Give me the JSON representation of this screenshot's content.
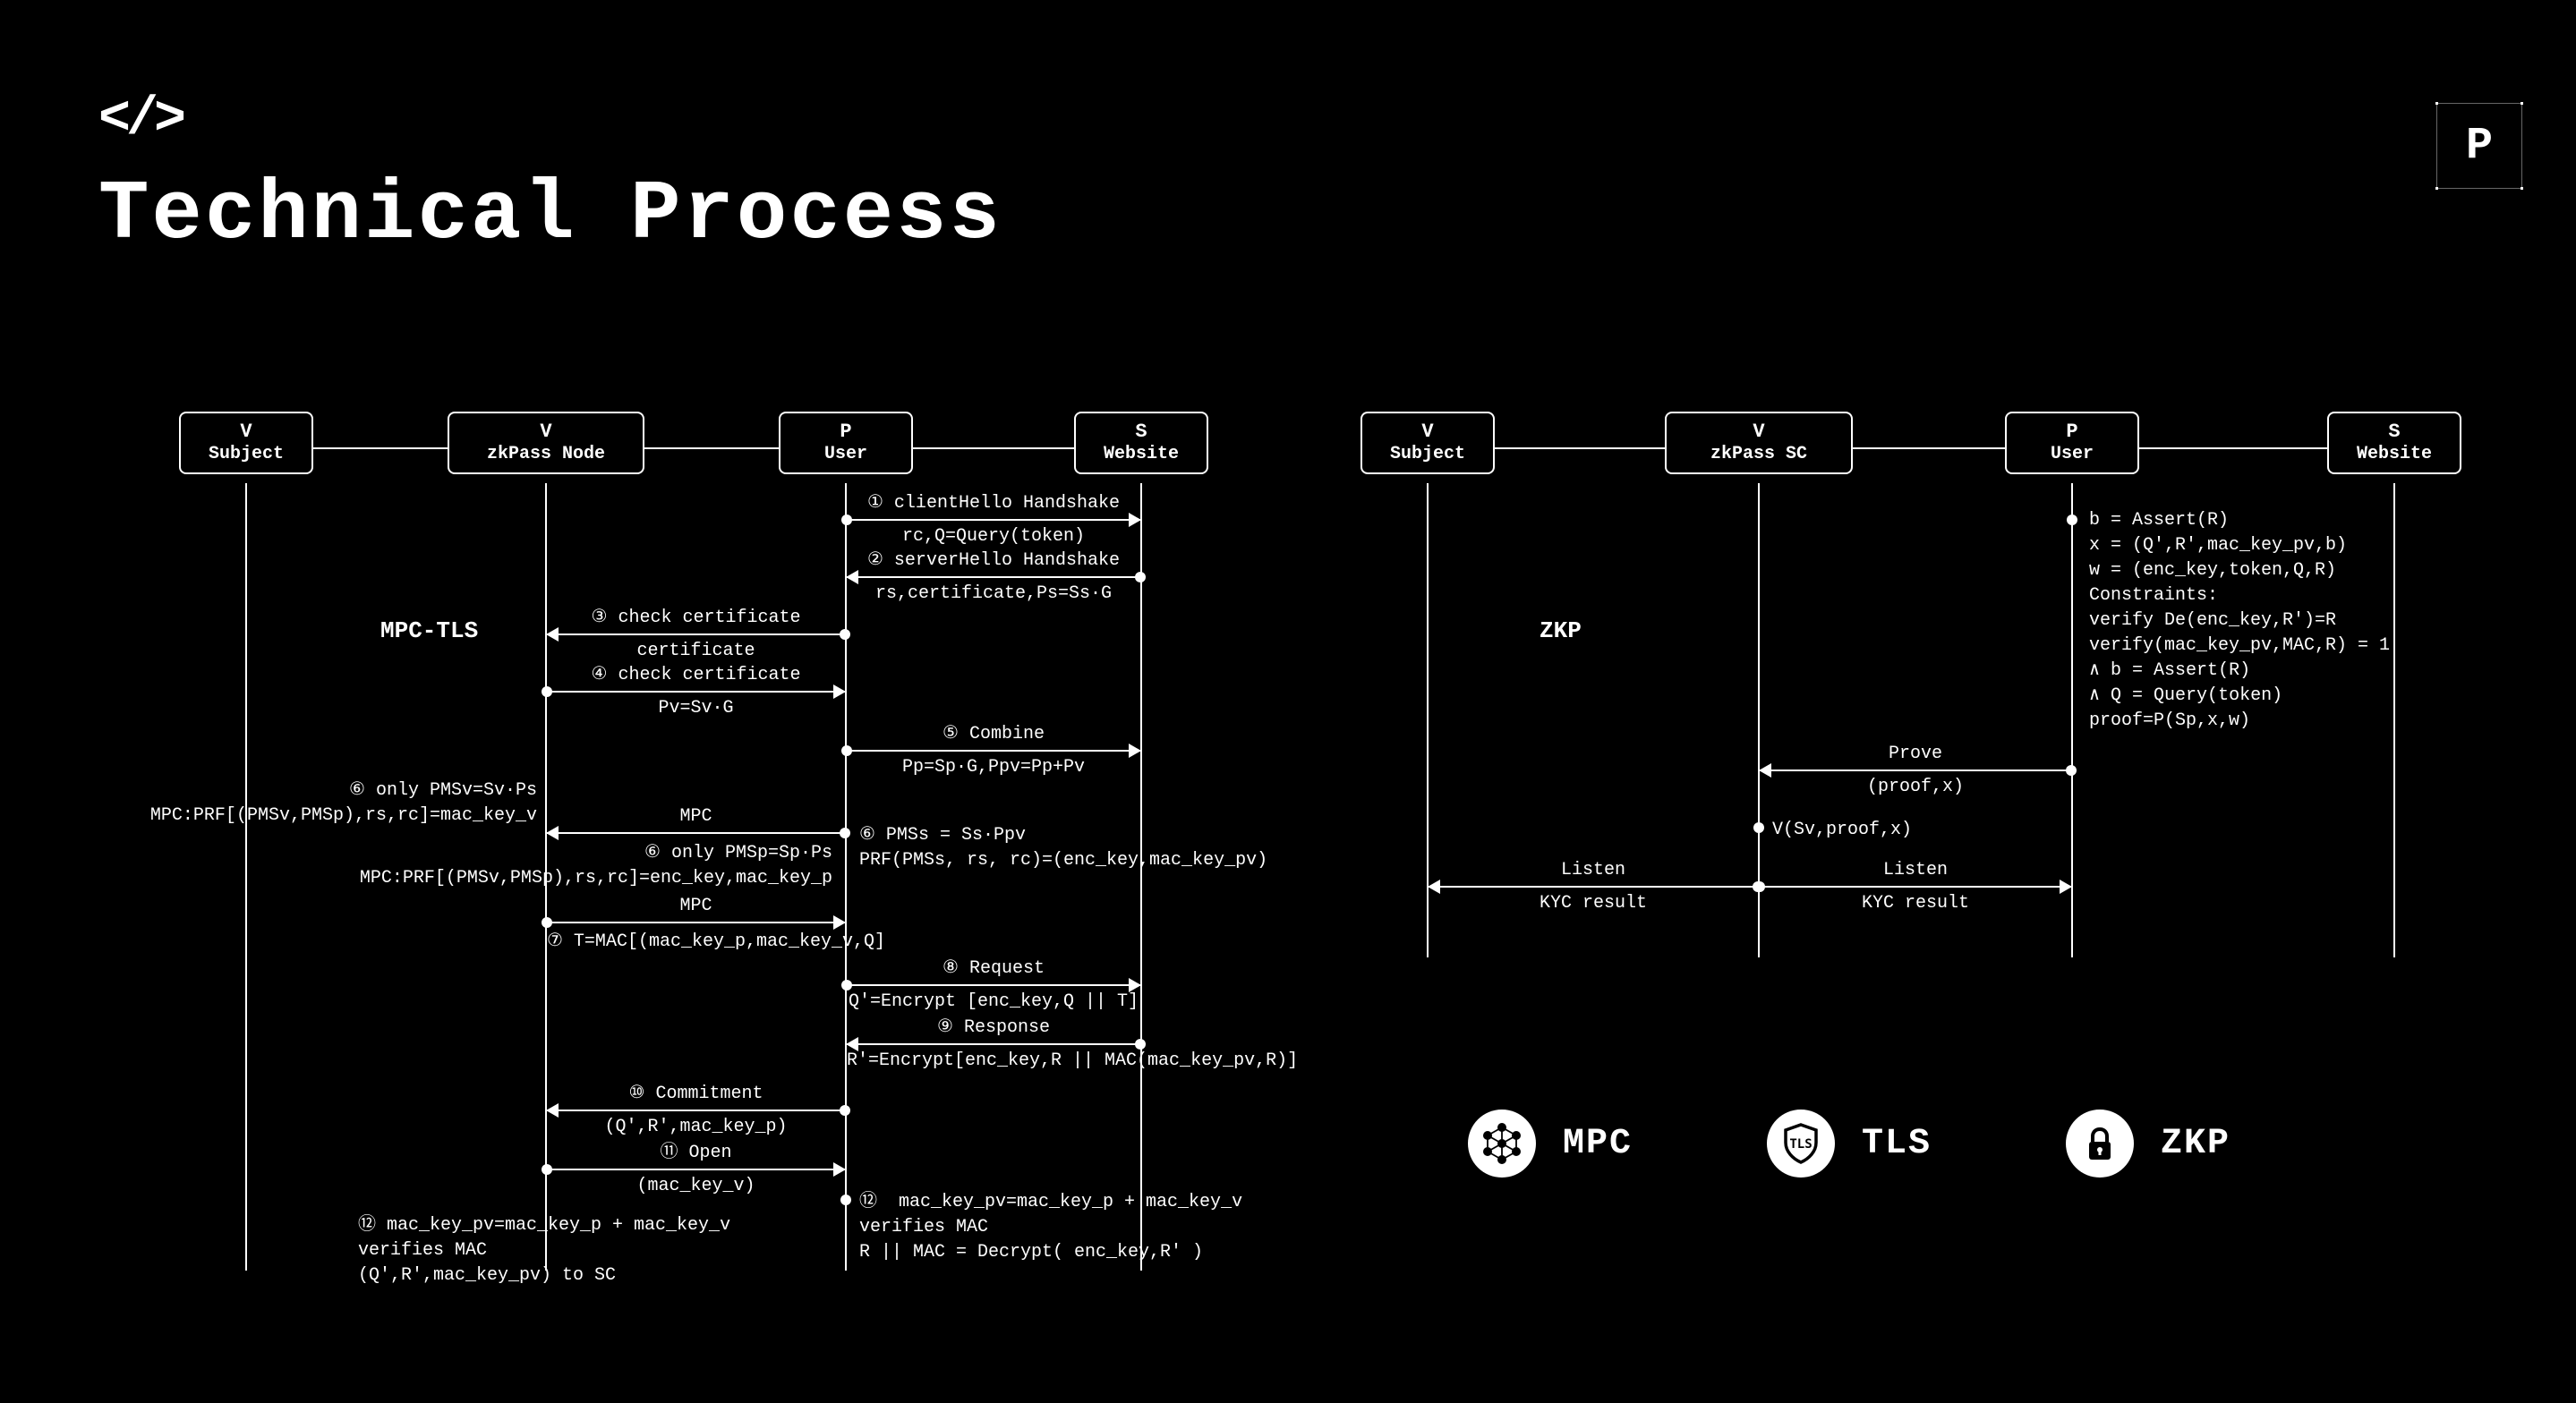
{
  "header": {
    "code_icon": "</>",
    "title": "Technical Process",
    "logo": "P"
  },
  "left_diagram": {
    "section": "MPC-TLS",
    "actors": [
      {
        "role": "V",
        "name": "Subject"
      },
      {
        "role": "V",
        "name": "zkPass Node"
      },
      {
        "role": "P",
        "name": "User"
      },
      {
        "role": "S",
        "name": "Website"
      }
    ],
    "msgs": {
      "m1a": "① clientHello Handshake",
      "m1b": "rc,Q=Query(token)",
      "m2a": "② serverHello Handshake",
      "m2b": "rs,certificate,Ps=Ss·G",
      "m3a": "③ check certificate",
      "m3b": "certificate",
      "m4a": "④ check certificate",
      "m4b": "Pv=Sv·G",
      "m5a": "⑤ Combine",
      "m5b": "Pp=Sp·G,Ppv=Pp+Pv",
      "m6l": "⑥ only PMSv=Sv·Ps\nMPC:PRF[(PMSv,PMSp),rs,rc]=mac_key_v",
      "m6r": "⑥ PMSs = Ss·Ppv\nPRF(PMSs, rs, rc)=(enc_key,mac_key_pv)",
      "mpc1": "MPC",
      "m6p": "⑥ only PMSp=Sp·Ps\nMPC:PRF[(PMSv,PMSp),rs,rc]=enc_key,mac_key_p",
      "mpc2": "MPC",
      "m7": "⑦ T=MAC[(mac_key_p,mac_key_v,Q]",
      "m8a": "⑧ Request",
      "m8b": "Q'=Encrypt [enc_key,Q || T]",
      "m9a": "⑨ Response",
      "m9b": "R'=Encrypt[enc_key,R || MAC(mac_key_pv,R)]",
      "m10a": "⑩ Commitment",
      "m10b": "(Q',R',mac_key_p)",
      "m11a": "⑪ Open",
      "m11b": "(mac_key_v)",
      "m12r": "⑫  mac_key_pv=mac_key_p + mac_key_v\nverifies MAC\nR || MAC = Decrypt( enc_key,R' )",
      "m12l": "⑫ mac_key_pv=mac_key_p + mac_key_v\nverifies MAC\n(Q',R',mac_key_pv) to SC"
    }
  },
  "right_diagram": {
    "section": "ZKP",
    "actors": [
      {
        "role": "V",
        "name": "Subject"
      },
      {
        "role": "V",
        "name": "zkPass SC"
      },
      {
        "role": "P",
        "name": "User"
      },
      {
        "role": "S",
        "name": "Website"
      }
    ],
    "proof_block": "b = Assert(R)\nx = (Q',R',mac_key_pv,b)\nw = (enc_key,token,Q,R)\nConstraints:\nverify De(enc_key,R')=R\nverify(mac_key_pv,MAC,R) = 1\n∧ b = Assert(R)\n∧ Q = Query(token)\nproof=P(Sp,x,w)",
    "msgs": {
      "prove_a": "Prove",
      "prove_b": "(proof,x)",
      "verify": "V(Sv,proof,x)",
      "listen_a": "Listen",
      "listen_b": "KYC result",
      "listen2_a": "Listen",
      "listen2_b": "KYC result"
    }
  },
  "pills": {
    "mpc": "MPC",
    "tls": "TLS",
    "zkp": "ZKP"
  }
}
